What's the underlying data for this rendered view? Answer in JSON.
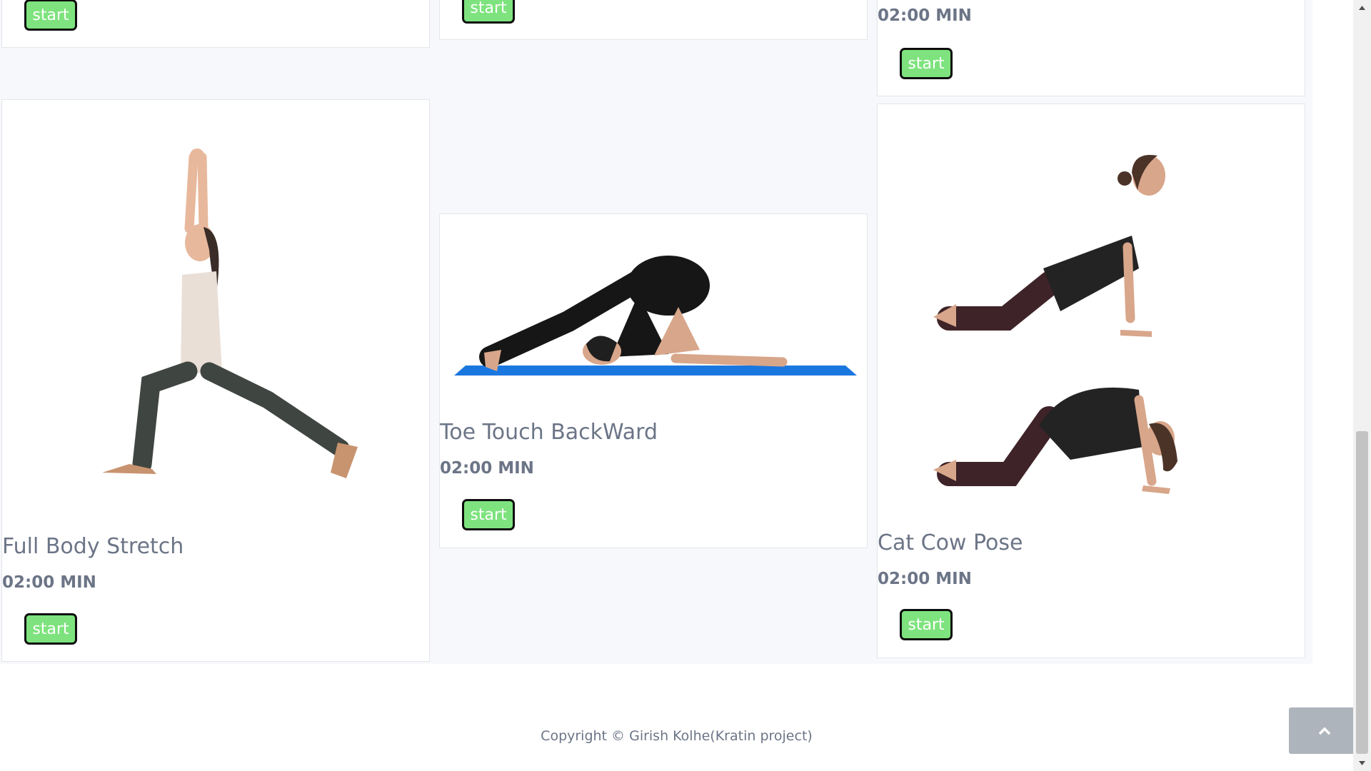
{
  "cards": [
    {
      "id": "top-left",
      "start_label": "start"
    },
    {
      "id": "top-middle",
      "start_label": "start"
    },
    {
      "id": "top-right",
      "duration": "02:00 MIN",
      "start_label": "start"
    },
    {
      "id": "full-body-stretch",
      "title": "Full Body Stretch",
      "duration": "02:00 MIN",
      "start_label": "start",
      "image": "warrior-lunge-pose"
    },
    {
      "id": "toe-touch-backward",
      "title": "Toe Touch BackWard",
      "duration": "02:00 MIN",
      "start_label": "start",
      "image": "plow-pose"
    },
    {
      "id": "cat-cow-pose",
      "title": "Cat Cow Pose",
      "duration": "02:00 MIN",
      "start_label": "start",
      "image": "cat-cow-pose"
    }
  ],
  "footer": {
    "copyright": "Copyright © Girish Kolhe(Kratin project)"
  },
  "back_to_top": {
    "icon": "chevron-up-icon"
  },
  "colors": {
    "start_button": "#7ee37e",
    "start_button_border": "#0d0d0d",
    "text": "#6c7587",
    "back_to_top": "#aeb4bc"
  }
}
